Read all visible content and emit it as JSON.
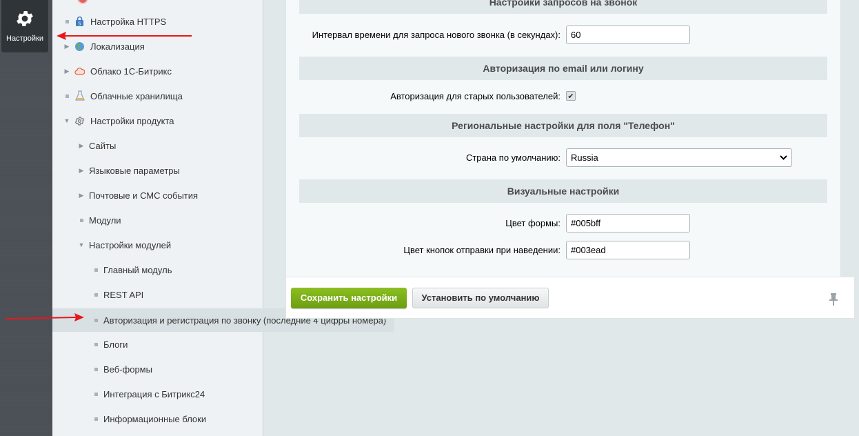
{
  "leftbar": {
    "settings_label": "Настройки"
  },
  "tree": {
    "items": [
      {
        "label": "Настройка HTTPS"
      },
      {
        "label": "Локализация"
      },
      {
        "label": "Облако 1С-Битрикс"
      },
      {
        "label": "Облачные хранилища"
      },
      {
        "label": "Настройки продукта"
      },
      {
        "label": "Сайты"
      },
      {
        "label": "Языковые параметры"
      },
      {
        "label": "Почтовые и СМС события"
      },
      {
        "label": "Модули"
      },
      {
        "label": "Настройки модулей"
      },
      {
        "label": "Главный модуль"
      },
      {
        "label": "REST API"
      },
      {
        "label": "Авторизация и регистрация по звонку (последние 4 цифры номера)"
      },
      {
        "label": "Блоги"
      },
      {
        "label": "Веб-формы"
      },
      {
        "label": "Интеграция с Битрикс24"
      },
      {
        "label": "Информационные блоки"
      }
    ]
  },
  "form": {
    "section_calls": "Настройки запросов на звонок",
    "interval_label": "Интервал времени для запроса нового звонка (в секундах):",
    "interval_value": "60",
    "section_auth": "Авторизация по email или логину",
    "old_users_label": "Авторизация для старых пользователей:",
    "old_users_checked": true,
    "section_regional": "Региональные настройки для поля \"Телефон\"",
    "country_label": "Страна по умолчанию:",
    "country_value": "Russia",
    "section_visual": "Визуальные настройки",
    "form_color_label": "Цвет формы:",
    "form_color_value": "#005bff",
    "hover_color_label": "Цвет кнопок отправки при наведении:",
    "hover_color_value": "#003ead"
  },
  "buttons": {
    "save_label": "Сохранить настройки",
    "default_label": "Установить по умолчанию"
  },
  "colors": {
    "accent_green": "#7aad17",
    "annotation_red": "#e8171b"
  }
}
